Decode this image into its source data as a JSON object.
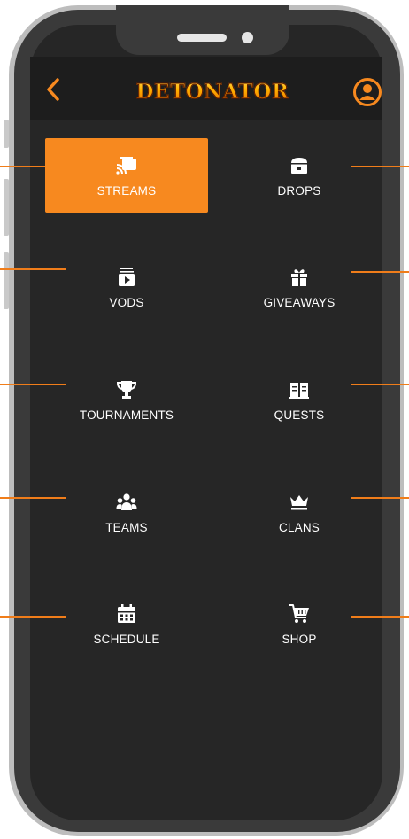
{
  "header": {
    "logo_text": "DETONATOR",
    "back_icon": "chevron-left-icon",
    "profile_icon": "user-circle-icon"
  },
  "colors": {
    "accent": "#f7891f",
    "screen_bg": "#262626",
    "header_bg": "#1d1d1d",
    "text": "#ffffff"
  },
  "menu": {
    "items": [
      {
        "label": "STREAMS",
        "icon": "cast-icon",
        "active": true
      },
      {
        "label": "DROPS",
        "icon": "treasure-chest-icon",
        "active": false
      },
      {
        "label": "VODS",
        "icon": "video-play-icon",
        "active": false
      },
      {
        "label": "GIVEAWAYS",
        "icon": "gift-icon",
        "active": false
      },
      {
        "label": "TOURNAMENTS",
        "icon": "trophy-icon",
        "active": false
      },
      {
        "label": "QUESTS",
        "icon": "book-icon",
        "active": false
      },
      {
        "label": "TEAMS",
        "icon": "users-icon",
        "active": false
      },
      {
        "label": "CLANS",
        "icon": "crown-icon",
        "active": false
      },
      {
        "label": "SCHEDULE",
        "icon": "calendar-icon",
        "active": false
      },
      {
        "label": "SHOP",
        "icon": "shopping-cart-icon",
        "active": false
      }
    ]
  }
}
